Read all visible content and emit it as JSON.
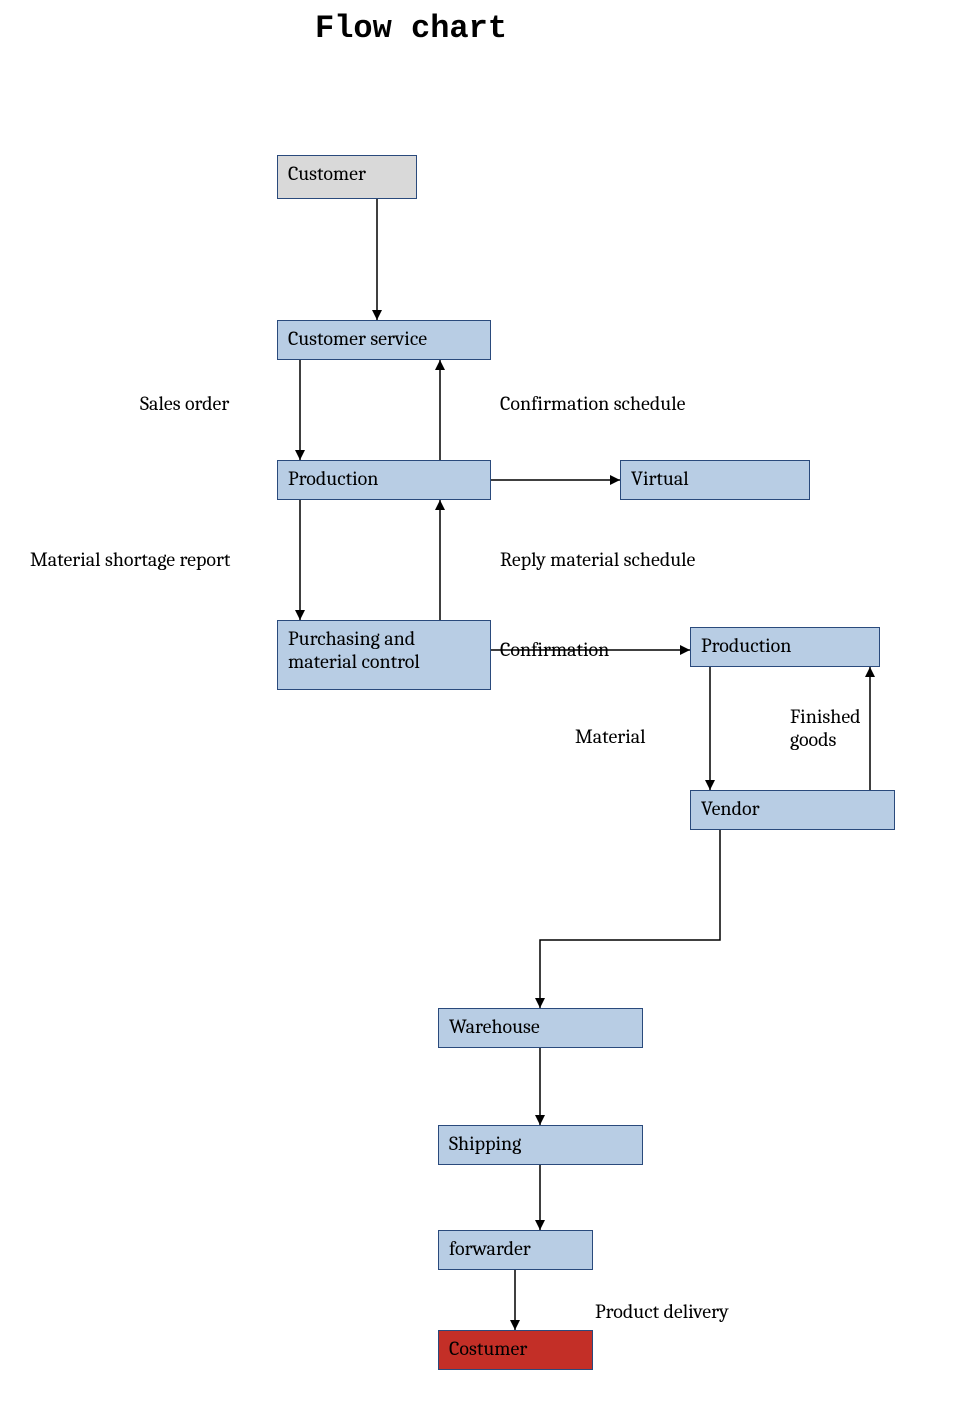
{
  "title": "Flow chart",
  "nodes": {
    "customer": "Customer",
    "customer_service": "Customer service",
    "production1": "Production",
    "virtual": "Virtual",
    "purchasing": "Purchasing and material control",
    "production2": "Production",
    "vendor": "Vendor",
    "warehouse": "Warehouse",
    "shipping": "Shipping",
    "forwarder": "forwarder",
    "costumer": "Costumer"
  },
  "labels": {
    "sales_order": "Sales order",
    "confirmation_schedule": "Confirmation schedule",
    "material_shortage": "Material shortage report",
    "reply_material": "Reply material schedule",
    "confirmation": "Confirmation",
    "material": "Material",
    "finished_goods": "Finished goods",
    "product_delivery": "Product delivery"
  }
}
